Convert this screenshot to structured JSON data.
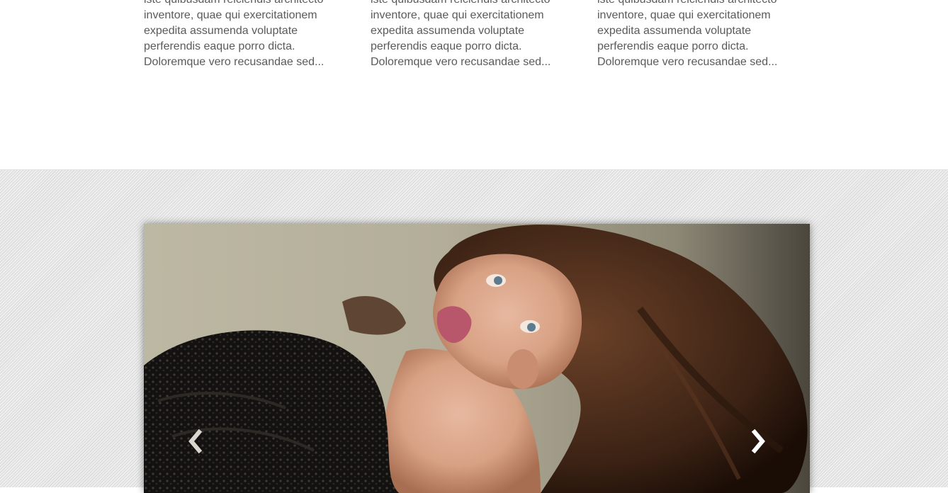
{
  "articles": [
    {
      "lines": [
        "iste quibusdam reiciendis architecto",
        "inventore, quae qui exercitationem",
        "expedita assumenda voluptate",
        "perferendis eaque porro dicta.",
        "Doloremque vero recusandae sed..."
      ]
    },
    {
      "lines": [
        "iste quibusdam reiciendis architecto",
        "inventore, quae qui exercitationem",
        "expedita assumenda voluptate",
        "perferendis eaque porro dicta.",
        "Doloremque vero recusandae sed..."
      ]
    },
    {
      "lines": [
        "iste quibusdam reiciendis architecto",
        "inventore, quae qui exercitationem",
        "expedita assumenda voluptate",
        "perferendis eaque porro dicta.",
        "Doloremque vero recusandae sed..."
      ]
    }
  ],
  "slider": {
    "prev_icon": "chevron-left-icon",
    "next_icon": "chevron-right-icon"
  },
  "colors": {
    "body_text": "#5a5a5a",
    "pattern_light": "#f1f1f1",
    "pattern_dark": "#dcdcdc"
  }
}
